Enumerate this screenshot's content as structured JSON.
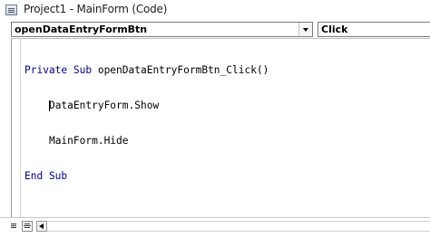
{
  "window": {
    "title": "Project1 - MainForm (Code)",
    "icon": "vba-module-icon"
  },
  "object_combo": {
    "selected": "openDataEntryFormBtn"
  },
  "procedure_combo": {
    "selected": "Click"
  },
  "code": {
    "lines": [
      {
        "indent": "",
        "keyword1": "Private Sub",
        "text": " openDataEntryFormBtn_Click()",
        "keyword2": ""
      },
      {
        "indent": "    ",
        "keyword1": "",
        "text": "DataEntryForm.Show",
        "keyword2": ""
      },
      {
        "indent": "    ",
        "keyword1": "",
        "text": "MainForm.Hide",
        "keyword2": ""
      },
      {
        "indent": "",
        "keyword1": "End Sub",
        "text": "",
        "keyword2": ""
      }
    ]
  },
  "colors": {
    "keyword": "#00008b",
    "text": "#000000",
    "background": "#ffffff"
  }
}
